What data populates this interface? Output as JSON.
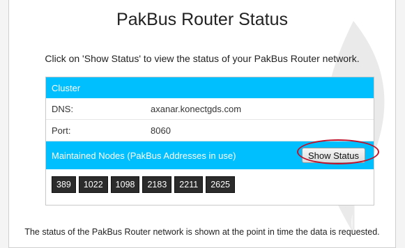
{
  "title": "PakBus Router Status",
  "intro": "Click on 'Show Status' to view the status of your PakBus Router network.",
  "panel": {
    "cluster_header": "Cluster",
    "rows": [
      {
        "label": "DNS:",
        "value": "axanar.konectgds.com"
      },
      {
        "label": "Port:",
        "value": "8060"
      }
    ],
    "nodes_header": "Maintained Nodes (PakBus Addresses in use)",
    "show_status_label": "Show Status",
    "nodes": [
      "389",
      "1022",
      "1098",
      "2183",
      "2211",
      "2625"
    ]
  },
  "footer": "The status of the PakBus Router network is shown at the point in time the data is requested.",
  "colors": {
    "header_bar": "#00bfff",
    "node_badge": "#2b2b2b",
    "highlight": "#c0112a"
  }
}
